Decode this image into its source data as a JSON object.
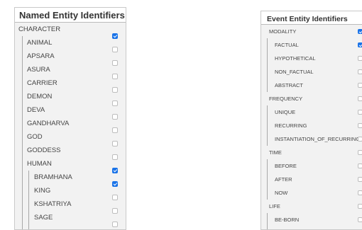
{
  "named_entities": {
    "title": "Named Entity Identifiers",
    "items": [
      {
        "label": "CHARACTER",
        "checked": true
      },
      {
        "label": "ANIMAL",
        "checked": false
      },
      {
        "label": "APSARA",
        "checked": false
      },
      {
        "label": "ASURA",
        "checked": false
      },
      {
        "label": "CARRIER",
        "checked": false
      },
      {
        "label": "DEMON",
        "checked": false
      },
      {
        "label": "DEVA",
        "checked": false
      },
      {
        "label": "GANDHARVA",
        "checked": false
      },
      {
        "label": "GOD",
        "checked": false
      },
      {
        "label": "GODDESS",
        "checked": false
      },
      {
        "label": "HUMAN",
        "checked": true
      },
      {
        "label": "BRAMHANA",
        "checked": true
      },
      {
        "label": "KING",
        "checked": false
      },
      {
        "label": "KSHATRIYA",
        "checked": false
      },
      {
        "label": "SAGE",
        "checked": false
      }
    ]
  },
  "event_entities": {
    "title": "Event Entity Identifiers",
    "items": [
      {
        "label": "MODALITY",
        "checked": true
      },
      {
        "label": "FACTUAL",
        "checked": true
      },
      {
        "label": "HYPOTHETICAL",
        "checked": false
      },
      {
        "label": "NON_FACTUAL",
        "checked": false
      },
      {
        "label": "ABSTRACT",
        "checked": false
      },
      {
        "label": "FREQUENCY",
        "checked": false
      },
      {
        "label": "UNIQUE",
        "checked": false
      },
      {
        "label": "RECURRING",
        "checked": false
      },
      {
        "label": "INSTANTIATION_OF_RECURRING",
        "checked": false
      },
      {
        "label": "TIME",
        "checked": false
      },
      {
        "label": "BEFORE",
        "checked": false
      },
      {
        "label": "AFTER",
        "checked": false
      },
      {
        "label": "NOW",
        "checked": false
      },
      {
        "label": "LIFE",
        "checked": false
      },
      {
        "label": "BE-BORN",
        "checked": false
      }
    ]
  }
}
